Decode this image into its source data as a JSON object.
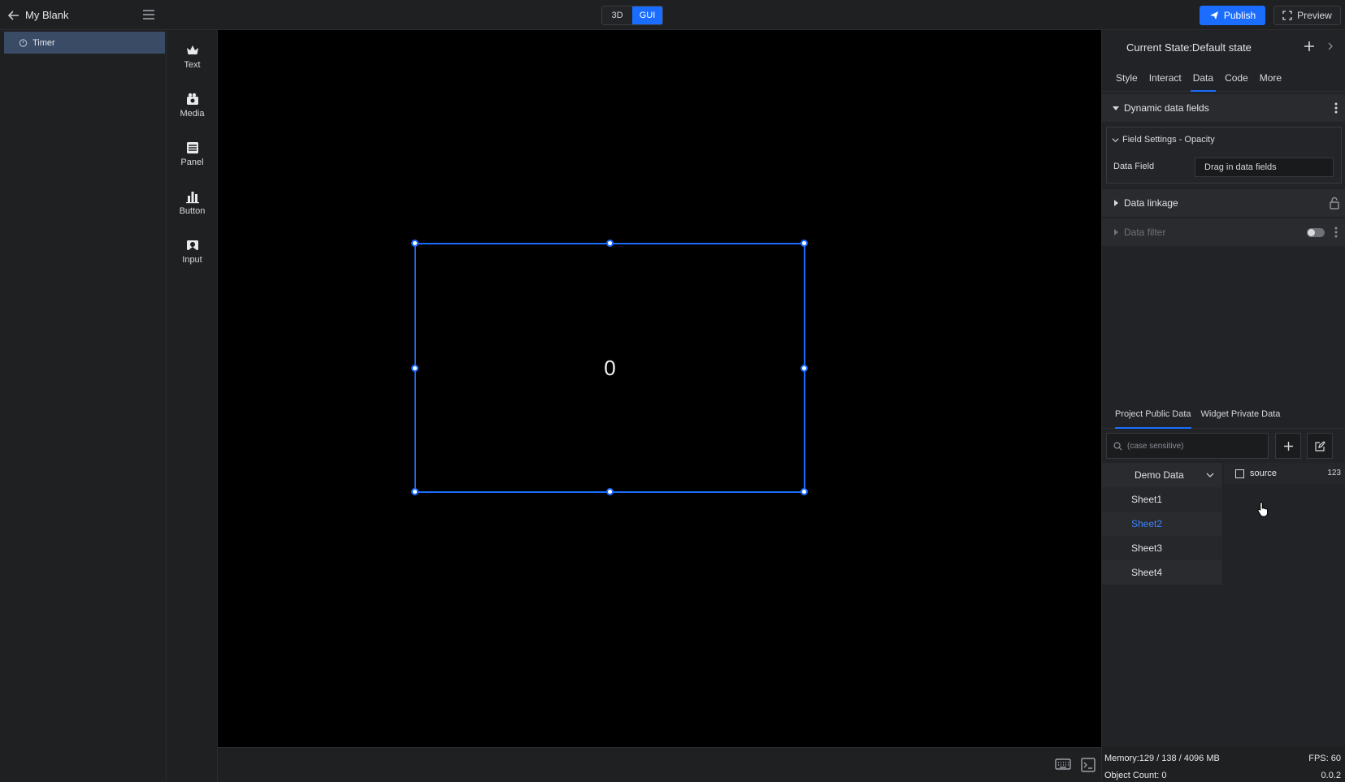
{
  "app": {
    "title": "My Blank"
  },
  "mode": {
    "options": [
      "3D",
      "GUI"
    ],
    "active": "GUI"
  },
  "header": {
    "publish_label": "Publish",
    "preview_label": "Preview"
  },
  "layers": [
    {
      "label": "Timer",
      "icon": "timer-icon",
      "selected": true
    }
  ],
  "widgets": [
    {
      "label": "Text",
      "icon": "text-widget-icon"
    },
    {
      "label": "Media",
      "icon": "media-widget-icon"
    },
    {
      "label": "Panel",
      "icon": "panel-widget-icon"
    },
    {
      "label": "Button",
      "icon": "button-widget-icon"
    },
    {
      "label": "Input",
      "icon": "input-widget-icon"
    }
  ],
  "canvas": {
    "timer_value": "0",
    "background": "#000000",
    "selection_color": "#1a6dff"
  },
  "right_panel": {
    "current_state": "Current State:Default state",
    "tabs": [
      "Style",
      "Interact",
      "Data",
      "Code",
      "More"
    ],
    "active_tab": "Data",
    "dynamic_fields_title": "Dynamic data fields",
    "field_settings_title": "Field Settings - Opacity",
    "data_field_label": "Data Field",
    "data_field_placeholder": "Drag in data fields",
    "data_linkage_title": "Data linkage",
    "data_filter_title": "Data filter"
  },
  "data_panel": {
    "tabs": [
      "Project Public Data",
      "Widget Private Data"
    ],
    "active_tab": "Project Public Data",
    "search_placeholder": "(case sensitive)",
    "source_name": "Demo Data",
    "sheets": [
      "Sheet1",
      "Sheet2",
      "Sheet3",
      "Sheet4"
    ],
    "active_sheet": "Sheet2",
    "fields": [
      {
        "name": "source",
        "type": "123"
      }
    ]
  },
  "status": {
    "memory": "Memory:129 / 138 / 4096 MB",
    "fps": "FPS: 60",
    "object_count": "Object Count: 0",
    "version": "0.0.2"
  },
  "colors": {
    "accent": "#1a6dff",
    "active_sheet": "#3b82ff",
    "panel_bg": "#222326"
  }
}
